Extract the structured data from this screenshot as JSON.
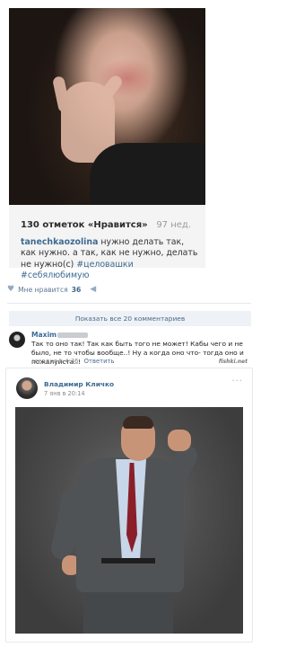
{
  "instagram": {
    "likes": "130 отметок «Нравится»",
    "age": "97 нед.",
    "username": "tanechkaozolina",
    "caption": " нужно делать так, как нужно. а так, как не нужно, делать не нужно(с) ",
    "hashtags": [
      "#целовашки",
      "#себялюбимую"
    ]
  },
  "vk_likebar": {
    "heart_icon": "heart-icon",
    "label": "Мне нравится",
    "count": "36",
    "share_icon": "megaphone-icon"
  },
  "comments_toggle": "Показать все 20 комментариев",
  "comment": {
    "author": "Maxim",
    "text": "Так то оно так! Так как быть того не может! Кабы чего и не было, не то чтобы вообще..! Ну а когда оно что- тогда оно и пожалуйста..!",
    "time": "сегодня в 4:36",
    "reply": "Ответить",
    "watermark": "fishki.net"
  },
  "post": {
    "author": "Владимир Кличко",
    "date": "7 янв в 20:14",
    "more_icon": "ellipsis-icon"
  },
  "colors": {
    "link": "#3d6b93",
    "bar_bg": "#eef1f5",
    "tie": "#8a1f2a"
  }
}
